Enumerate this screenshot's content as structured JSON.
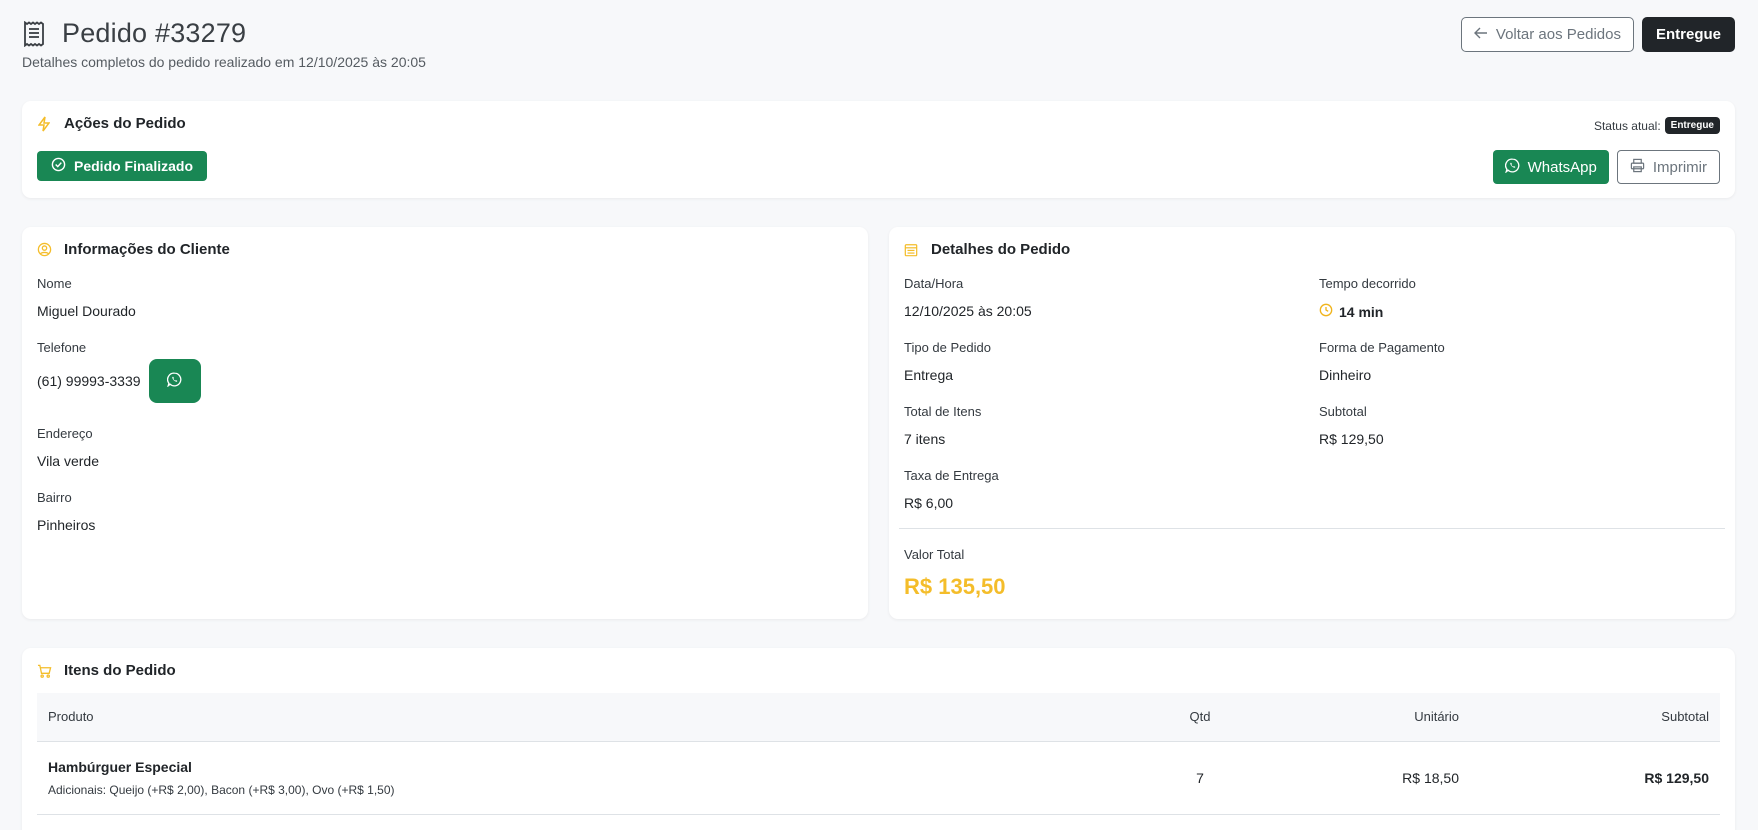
{
  "header": {
    "title": "Pedido #33279",
    "subtitle": "Detalhes completos do pedido realizado em 12/10/2025 às 20:05",
    "back_label": "Voltar aos Pedidos",
    "status_label": "Entregue"
  },
  "actions": {
    "title": "Ações do Pedido",
    "finalizado_label": "Pedido Finalizado",
    "status_prefix": "Status atual:",
    "status_badge": "Entregue",
    "whatsapp_label": "WhatsApp",
    "print_label": "Imprimir"
  },
  "client": {
    "title": "Informações do Cliente",
    "name_label": "Nome",
    "name": "Miguel Dourado",
    "phone_label": "Telefone",
    "phone": "(61) 99993-3339",
    "address_label": "Endereço",
    "address": "Vila verde",
    "district_label": "Bairro",
    "district": "Pinheiros"
  },
  "details": {
    "title": "Detalhes do Pedido",
    "datetime_label": "Data/Hora",
    "datetime": "12/10/2025 às 20:05",
    "elapsed_label": "Tempo decorrido",
    "elapsed": "14 min",
    "type_label": "Tipo de Pedido",
    "type": "Entrega",
    "payment_label": "Forma de Pagamento",
    "payment": "Dinheiro",
    "items_label": "Total de Itens",
    "items": "7 itens",
    "subtotal_label": "Subtotal",
    "subtotal": "R$ 129,50",
    "fee_label": "Taxa de Entrega",
    "fee": "R$ 6,00",
    "total_label": "Valor Total",
    "total": "R$ 135,50"
  },
  "items": {
    "title": "Itens do Pedido",
    "columns": [
      "Produto",
      "Qtd",
      "Unitário",
      "Subtotal"
    ],
    "rows": [
      {
        "product": "Hambúrguer Especial",
        "additions": "Adicionais: Queijo (+R$ 2,00), Bacon (+R$ 3,00), Ovo (+R$ 1,50)",
        "qty": "7",
        "unit": "R$ 18,50",
        "subtotal": "R$ 129,50"
      }
    ]
  },
  "colors": {
    "accent": "#f4bd2a",
    "success": "#198754",
    "dark": "#212529"
  }
}
